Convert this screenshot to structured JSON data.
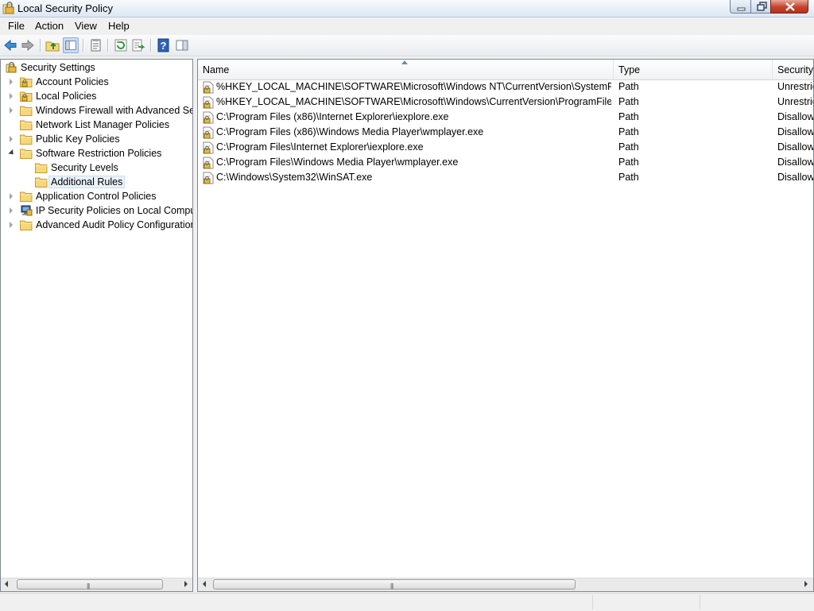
{
  "window": {
    "title": "Local Security Policy"
  },
  "menu": [
    "File",
    "Action",
    "View",
    "Help"
  ],
  "toolbar": {
    "buttons": [
      "back-arrow-icon",
      "forward-arrow-icon",
      "up-folder-icon",
      "show-hide-console-tree-icon",
      "properties-icon",
      "refresh-icon",
      "export-list-icon",
      "help-icon",
      "show-hide-action-pane-icon"
    ]
  },
  "tree": {
    "items": [
      {
        "label": "Security Settings",
        "state": "root",
        "icon": "security-settings-icon"
      },
      {
        "label": "Account Policies",
        "state": "collapsed",
        "icon": "lock-folder-icon"
      },
      {
        "label": "Local Policies",
        "state": "collapsed",
        "icon": "lock-folder-icon"
      },
      {
        "label": "Windows Firewall with Advanced Secu",
        "state": "collapsed",
        "icon": "folder-icon"
      },
      {
        "label": "Network List Manager Policies",
        "state": "leaf",
        "icon": "folder-icon"
      },
      {
        "label": "Public Key Policies",
        "state": "collapsed",
        "icon": "folder-icon"
      },
      {
        "label": "Software Restriction Policies",
        "state": "expanded",
        "icon": "folder-icon"
      },
      {
        "label": "Security Levels",
        "state": "leaf",
        "icon": "folder-icon"
      },
      {
        "label": "Additional Rules",
        "state": "leaf",
        "icon": "folder-icon",
        "selected": true
      },
      {
        "label": "Application Control Policies",
        "state": "collapsed",
        "icon": "folder-icon"
      },
      {
        "label": "IP Security Policies on Local Compute",
        "state": "collapsed",
        "icon": "ip-security-icon"
      },
      {
        "label": "Advanced Audit Policy Configuration",
        "state": "collapsed",
        "icon": "folder-icon"
      }
    ]
  },
  "list": {
    "columns": [
      "Name",
      "Type",
      "Security"
    ],
    "rows": [
      {
        "name": "%HKEY_LOCAL_MACHINE\\SOFTWARE\\Microsoft\\Windows NT\\CurrentVersion\\SystemRoot%",
        "type": "Path",
        "security": "Unrestric"
      },
      {
        "name": "%HKEY_LOCAL_MACHINE\\SOFTWARE\\Microsoft\\Windows\\CurrentVersion\\ProgramFilesDir%",
        "type": "Path",
        "security": "Unrestric"
      },
      {
        "name": "C:\\Program Files (x86)\\Internet Explorer\\iexplore.exe",
        "type": "Path",
        "security": "Disallow"
      },
      {
        "name": "C:\\Program Files (x86)\\Windows Media Player\\wmplayer.exe",
        "type": "Path",
        "security": "Disallow"
      },
      {
        "name": "C:\\Program Files\\Internet Explorer\\iexplore.exe",
        "type": "Path",
        "security": "Disallow"
      },
      {
        "name": "C:\\Program Files\\Windows Media Player\\wmplayer.exe",
        "type": "Path",
        "security": "Disallow"
      },
      {
        "name": "C:\\Windows\\System32\\WinSAT.exe",
        "type": "Path",
        "security": "Disallow"
      }
    ]
  },
  "colors": {
    "accent": "#c9dcf3",
    "folder": "#f6d77a",
    "close": "#c5432c"
  }
}
